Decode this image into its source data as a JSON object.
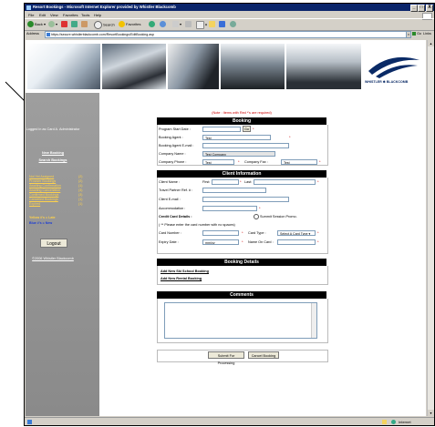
{
  "window": {
    "title": "Resort Bookings - Microsoft Internet Explorer provided by Whistler Blackcomb",
    "controls": [
      "_",
      "□",
      "X"
    ]
  },
  "menu": [
    "File",
    "Edit",
    "View",
    "Favorites",
    "Tools",
    "Help"
  ],
  "toolbar": {
    "back": "Back",
    "search": "Search",
    "favorites": "Favorites"
  },
  "address": {
    "label": "Address",
    "url": "https://secure.whistlerblackcomb.com/ResortBookings/EditBooking.asp",
    "go": "Go",
    "links": "Links"
  },
  "brand": {
    "logo_text": "WHISTLER ✱ BLACKCOMB"
  },
  "sidebar": {
    "logged_in": "Logged in as Card A. Administrator",
    "links_top": [
      "New Booking",
      "Search Bookings"
    ],
    "stat_links": [
      {
        "label": "Not Yet Assigned",
        "count": "(2)"
      },
      {
        "label": "Provider Bookings",
        "count": "(2)"
      },
      {
        "label": "Awaiting Confirmation",
        "count": "(1)"
      },
      {
        "label": "Awaiting Cancellation",
        "count": "(3)"
      },
      {
        "label": "Confirmed Bookings",
        "count": "(3)"
      },
      {
        "label": "Cancelled Bookings",
        "count": "(1)"
      },
      {
        "label": "Expired",
        "count": "(1)"
      }
    ],
    "legend_late": "Yellow #'s = Late",
    "legend_new": "Blue #'s = New",
    "logout": "Logout",
    "copyright": "©2006 Whistler Blackcomb"
  },
  "form": {
    "note": "(Note : Items with Red *'s are required)",
    "booking_header": "Booking",
    "program_start_label": "Program Start Date :",
    "program_start_value": "",
    "go_btn": "Go",
    "booking_agent_label": "Booking Agent :",
    "booking_agent_value": "Test",
    "agent_email_label": "Booking Agent E-mail :",
    "agent_email_value": "",
    "company_name_label": "Company Name :",
    "company_name_value": "Test Company",
    "company_phone_label": "Company Phone :",
    "company_phone_value": "Test",
    "company_fax_label": "Company Fax :",
    "company_fax_value": "Test",
    "client_header": "Client Information",
    "client_name_label": "Client Name :",
    "first_label": "First:",
    "last_label": "Last:",
    "travel_ref_label": "Travel Partner Ref. # :",
    "client_email_label": "Client E-mail :",
    "accommodation_label": "Accommodation :",
    "cc_details_label": "Credit Card Details :",
    "summit_label": "Summit Session Promo.",
    "cc_note": "( ** Please enter the card number with no spaces)",
    "card_number_label": "Card Number :",
    "card_type_label": "Card Type :",
    "card_type_value": "Select A Card Type",
    "expiry_label": "Expiry Date :",
    "expiry_value": "mm/yy",
    "name_on_card_label": "Name On Card :",
    "details_header": "Booking Details",
    "add_ski_school": "Add New Ski School Booking",
    "add_rental": "Add New Rental Booking",
    "comments_header": "Comments",
    "submit_btn": "Submit For Processing",
    "cancel_btn": "Cancel Booking"
  },
  "status": {
    "zone": "Internet"
  }
}
